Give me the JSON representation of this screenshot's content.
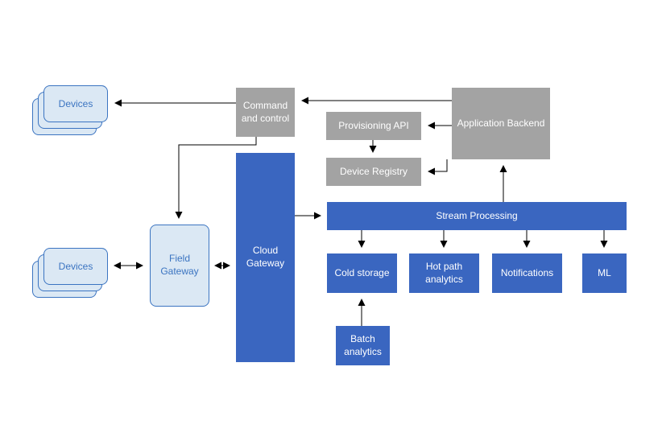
{
  "devices": {
    "label": "Devices"
  },
  "fieldGateway": {
    "label": "Field Gateway"
  },
  "cloudGateway": {
    "label": "Cloud Gateway"
  },
  "commandControl": {
    "label": "Command and control"
  },
  "provisioningApi": {
    "label": "Provisioning API"
  },
  "deviceRegistry": {
    "label": "Device Registry"
  },
  "applicationBackend": {
    "label": "Application Backend"
  },
  "streamProcessing": {
    "label": "Stream Processing"
  },
  "coldStorage": {
    "label": "Cold storage"
  },
  "hotPath": {
    "label": "Hot path analytics"
  },
  "notifications": {
    "label": "Notifications"
  },
  "ml": {
    "label": "ML"
  },
  "batchAnalytics": {
    "label": "Batch analytics"
  }
}
